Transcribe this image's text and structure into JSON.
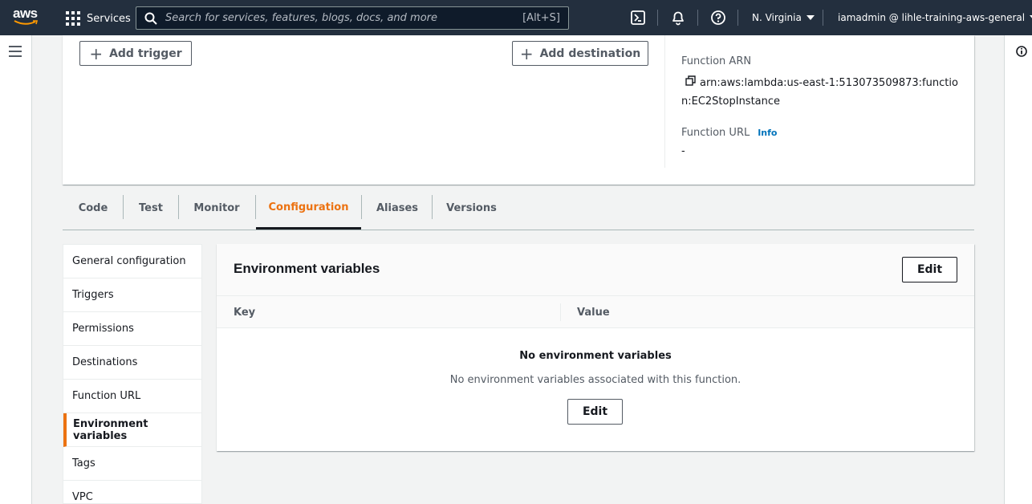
{
  "topnav": {
    "logo_text": "aws",
    "services_label": "Services",
    "search_placeholder": "Search for services, features, blogs, docs, and more",
    "search_shortcut": "[Alt+S]",
    "region": "N. Virginia",
    "user": "iamadmin @ lihle-training-aws-general"
  },
  "overview": {
    "add_trigger": "Add trigger",
    "add_destination": "Add destination",
    "arn_label": "Function ARN",
    "arn_line1": "arn:aws:lambda:us-east-1:513073509873:functio",
    "arn_line2": "n:EC2StopInstance",
    "url_label": "Function URL",
    "url_info": "Info",
    "url_value": "-"
  },
  "tabs": [
    {
      "label": "Code"
    },
    {
      "label": "Test"
    },
    {
      "label": "Monitor"
    },
    {
      "label": "Configuration"
    },
    {
      "label": "Aliases"
    },
    {
      "label": "Versions"
    }
  ],
  "active_tab": "Configuration",
  "sidenav": [
    {
      "label": "General configuration"
    },
    {
      "label": "Triggers"
    },
    {
      "label": "Permissions"
    },
    {
      "label": "Destinations"
    },
    {
      "label": "Function URL"
    },
    {
      "label": "Environment variables"
    },
    {
      "label": "Tags"
    },
    {
      "label": "VPC"
    }
  ],
  "active_sidenav": "Environment variables",
  "env_panel": {
    "title": "Environment variables",
    "edit_label": "Edit",
    "col_key": "Key",
    "col_value": "Value",
    "empty_title": "No environment variables",
    "empty_desc": "No environment variables associated with this function.",
    "empty_edit_label": "Edit"
  },
  "colors": {
    "nav_bg": "#232f3e",
    "accent": "#ec7211",
    "link": "#0073bb"
  }
}
